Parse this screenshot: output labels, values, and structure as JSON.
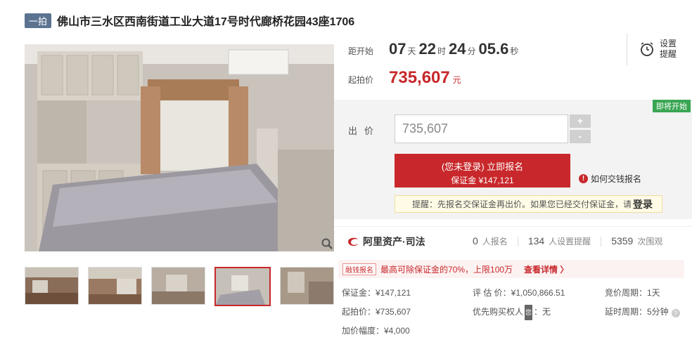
{
  "title": {
    "round_badge": "一拍",
    "text": "佛山市三水区西南街道工业大道17号时代廊桥花园43座1706"
  },
  "countdown": {
    "label": "距开始",
    "days": "07",
    "days_unit": "天",
    "hours": "22",
    "hours_unit": "时",
    "minutes": "24",
    "minutes_unit": "分",
    "seconds": "05.6",
    "seconds_unit": "秒"
  },
  "start_price": {
    "label": "起拍价",
    "value": "735,607",
    "unit": "元"
  },
  "remind": {
    "label": "设置提醒",
    "icon": "alarm-clock-icon"
  },
  "bid": {
    "soon_badge": "即将开始",
    "label": "出价",
    "input_value": "735,607",
    "plus": "+",
    "minus": "-",
    "signup_line1": "(您未登录) 立即报名",
    "signup_line2": "保证金 ¥147,121",
    "howpay": "如何交钱报名",
    "tip_prefix": "提醒：先报名交保证金再出价。如果您已经交付保证金，请",
    "tip_login": "登录"
  },
  "stats": {
    "brand": "阿里资产·司法",
    "signups_num": "0",
    "signups_label": "人报名",
    "reminders_num": "134",
    "reminders_label": "人设置提醒",
    "views_num": "5359",
    "views_label": "次围观"
  },
  "promo": {
    "tag": "融钱报名",
    "message": "最高可除保证金的70%，上限100万",
    "more": "查看详情 〉"
  },
  "info": {
    "deposit": "保证金：¥147,121",
    "appraisal": "评 估 价：¥1,050,866.51",
    "period": "竞价周期：1天",
    "start_price": "起拍价：¥735,607",
    "priority_prefix": "优先购买权人",
    "priority_badge": "您",
    "priority_value": "：无",
    "delay": "延时周期：5分钟",
    "increment": "加价幅度：¥4,000"
  },
  "colors": {
    "accent": "#c8282b",
    "badge_blue": "#5b7391",
    "green": "#3aa653"
  },
  "icons": [
    "zoom-icon",
    "alarm-clock-icon",
    "info-icon",
    "alibaba-logo-icon",
    "question-icon"
  ]
}
